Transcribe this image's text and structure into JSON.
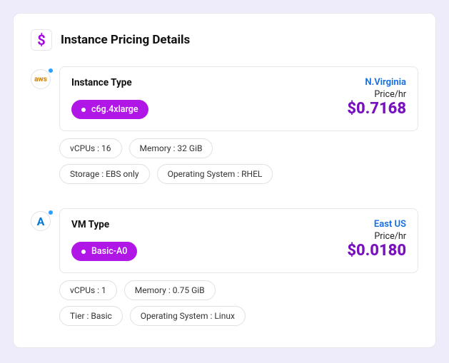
{
  "header": {
    "title": "Instance Pricing Details",
    "icon_glyph": "$"
  },
  "instances": [
    {
      "provider_icon": "aws",
      "provider_label": "aws",
      "type_heading": "Instance Type",
      "type_value": "c6g.4xlarge",
      "region": "N.Virginia",
      "price_label": "Price/hr",
      "price": "$0.7168",
      "specs_row1": [
        "vCPUs : 16",
        "Memory : 32 GiB"
      ],
      "specs_row2": [
        "Storage : EBS only",
        "Operating System : RHEL"
      ]
    },
    {
      "provider_icon": "azure",
      "provider_label": "A",
      "type_heading": "VM Type",
      "type_value": "Basic-A0",
      "region": "East US",
      "price_label": "Price/hr",
      "price": "$0.0180",
      "specs_row1": [
        "vCPUs : 1",
        "Memory : 0.75 GiB"
      ],
      "specs_row2": [
        "Tier : Basic",
        "Operating System : Linux"
      ]
    }
  ]
}
